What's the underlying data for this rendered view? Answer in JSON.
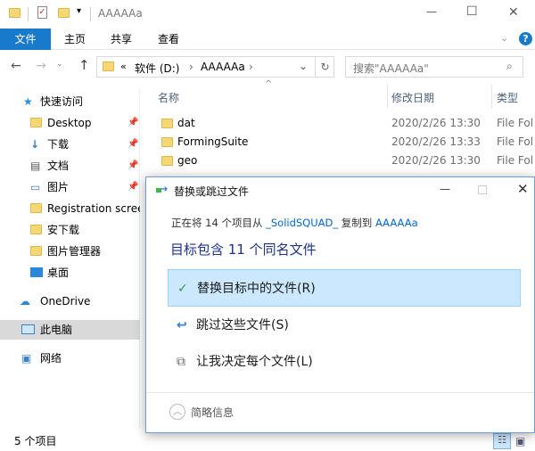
{
  "window": {
    "title": "AAAAAa",
    "minimize": "—",
    "maximize": "☐",
    "close": "✕"
  },
  "ribbon": {
    "tabs": [
      "文件",
      "主页",
      "共享",
      "查看"
    ],
    "help": "?"
  },
  "address": {
    "crumbs": [
      "«",
      "软件 (D:)",
      "›",
      "AAAAAa",
      "›"
    ],
    "search_placeholder": "搜索\"AAAAAa\""
  },
  "columns": {
    "name": "名称",
    "date": "修改日期",
    "type": "类型"
  },
  "files": [
    {
      "name": "dat",
      "date": "2020/2/26 13:30",
      "type": "File Fol"
    },
    {
      "name": "FormingSuite",
      "date": "2020/2/26 13:33",
      "type": "File Fol"
    },
    {
      "name": "geo",
      "date": "2020/2/26 13:30",
      "type": "File Fol"
    }
  ],
  "nav": {
    "quick_access": "快速访问",
    "items": [
      "Desktop",
      "下载",
      "文档",
      "图片",
      "Registration scree",
      "安下载",
      "图片管理器",
      "桌面"
    ],
    "onedrive": "OneDrive",
    "this_pc": "此电脑",
    "network": "网络"
  },
  "status": {
    "count": "5 个项目"
  },
  "dialog": {
    "title": "替换或跳过文件",
    "line_prefix": "正在将 14 个项目从 ",
    "source": "_SolidSQUAD_",
    "line_mid": " 复制到 ",
    "dest": "AAAAAa",
    "heading": "目标包含 11 个同名文件",
    "options": [
      "替换目标中的文件(R)",
      "跳过这些文件(S)",
      "让我决定每个文件(L)"
    ],
    "footer": "简略信息",
    "colors": {
      "accent": "#1979ca",
      "highlight": "#cce8ff",
      "link": "#0066cc"
    }
  }
}
